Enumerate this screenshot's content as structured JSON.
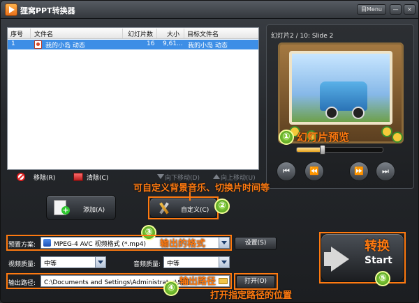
{
  "window": {
    "title": "狸窝PPT转换器",
    "menu_label": "Menu",
    "menu_prefix": "目",
    "minimize_label": "—",
    "close_label": "×"
  },
  "file_list": {
    "columns": [
      "序号",
      "文件名",
      "幻灯片数",
      "大小",
      "目标文件名"
    ],
    "rows": [
      {
        "index": "1",
        "name": "我的小岛 动态",
        "slides": "16",
        "size": "9,61...",
        "target": "我的小岛 动态"
      }
    ]
  },
  "list_actions": {
    "remove": "移除(R)",
    "clear": "清除(C)",
    "move_down": "向下移动(D)",
    "move_up": "向上移动(U)"
  },
  "preview": {
    "title": "幻灯片2 / 10: Slide 2",
    "progress": 0.3
  },
  "buttons": {
    "add": "添加(A)",
    "custom": "自定义(C)",
    "settings": "设置(S)",
    "open": "打开(O)",
    "convert": "Start"
  },
  "form": {
    "preset_label": "预置方案:",
    "preset_value": "MPEG-4 AVC 视频格式 (*.mp4)",
    "video_quality_label": "视频质量:",
    "video_quality_value": "中等",
    "audio_quality_label": "音频质量:",
    "audio_quality_value": "中等",
    "output_path_label": "输出路径:",
    "output_path_value": "C:\\Documents and Settings\\Administrator\\桌面"
  },
  "annotations": {
    "preview_note": "幻灯片预览",
    "custom_note": "可自定义背景音乐、切换片时间等",
    "format_note": "输出的格式",
    "path_note": "输出路径",
    "open_note": "打开指定路径的位置",
    "convert_note": "转换",
    "badges": [
      "①",
      "②",
      "③",
      "④",
      "⑤"
    ]
  },
  "colors": {
    "accent": "#ff7a10",
    "selection": "#3d8ee6",
    "badge": "#5cb31c"
  }
}
